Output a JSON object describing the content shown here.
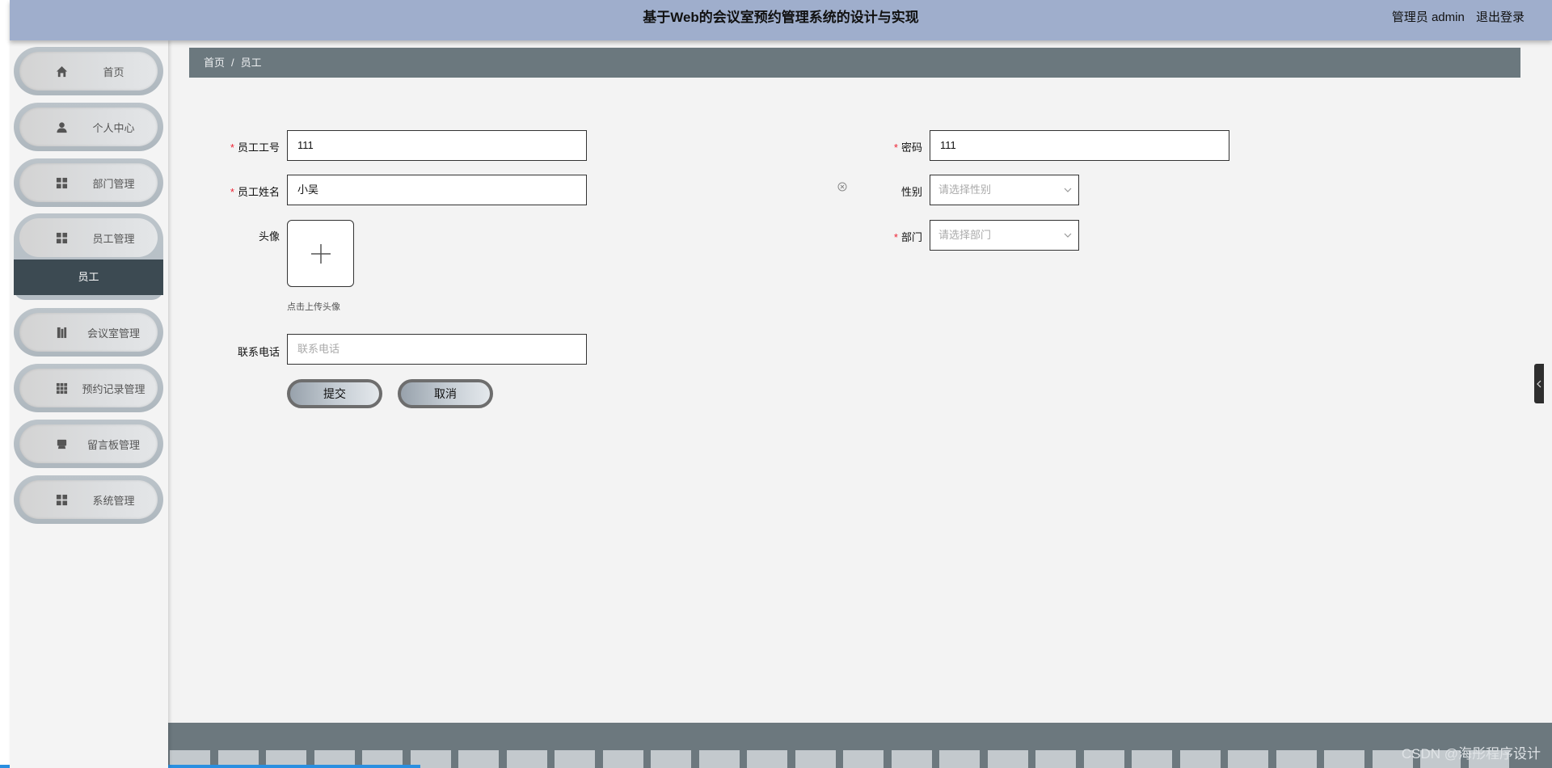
{
  "header": {
    "title": "基于Web的会议室预约管理系统的设计与实现",
    "user_label": "管理员 admin",
    "logout_label": "退出登录"
  },
  "sidebar": {
    "items": [
      {
        "label": "首页",
        "icon": "home-icon"
      },
      {
        "label": "个人中心",
        "icon": "user-icon"
      },
      {
        "label": "部门管理",
        "icon": "grid-icon"
      },
      {
        "label": "员工管理",
        "icon": "grid-icon",
        "submenu": "员工"
      },
      {
        "label": "会议室管理",
        "icon": "book-icon"
      },
      {
        "label": "预约记录管理",
        "icon": "apps-icon"
      },
      {
        "label": "留言板管理",
        "icon": "chat-icon"
      },
      {
        "label": "系统管理",
        "icon": "grid-icon"
      }
    ]
  },
  "breadcrumb": {
    "home": "首页",
    "separator": "/",
    "current": "员工"
  },
  "form": {
    "employee_no": {
      "label": "员工工号",
      "value": "111",
      "required": true
    },
    "password": {
      "label": "密码",
      "value": "111",
      "required": true
    },
    "employee_name": {
      "label": "员工姓名",
      "value": "小吴",
      "required": true
    },
    "gender": {
      "label": "性别",
      "placeholder": "请选择性别",
      "required": false
    },
    "avatar": {
      "label": "头像",
      "hint": "点击上传头像"
    },
    "department": {
      "label": "部门",
      "placeholder": "请选择部门",
      "required": true
    },
    "phone": {
      "label": "联系电话",
      "placeholder": "联系电话"
    },
    "submit_label": "提交",
    "cancel_label": "取消"
  },
  "watermark": "CSDN @海彤程序设计",
  "colors": {
    "header_bg": "#9faecc",
    "breadcrumb_bg": "#6b787e",
    "submenu_bg": "#3c4a52",
    "required": "#ee2233",
    "footer_bg": "#6c787e"
  }
}
